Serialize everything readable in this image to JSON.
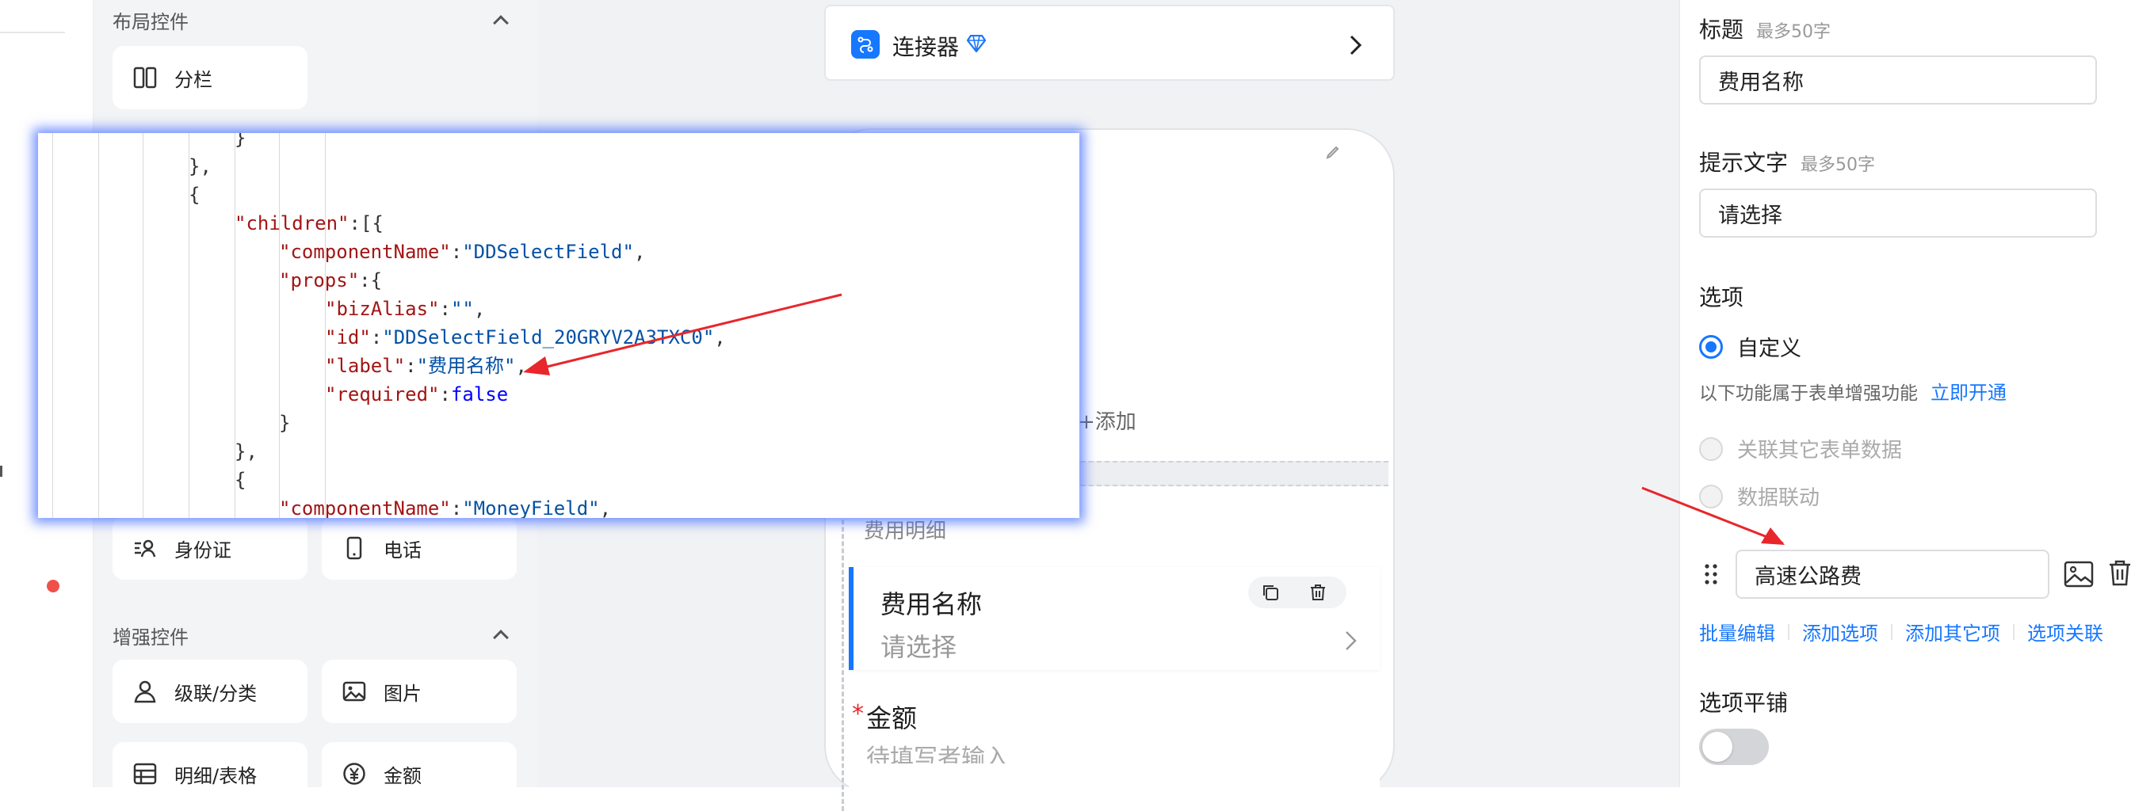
{
  "layout_panel": {
    "section_layout": "布局控件",
    "tile_columns": "分栏",
    "tile_idcard": "身份证",
    "tile_phone": "电话",
    "section_enhanced": "增强控件",
    "tile_cascade": "级联/分类",
    "tile_image": "图片",
    "tile_detail": "明细/表格",
    "tile_amount": "金额"
  },
  "canvas": {
    "connector_label": "连接器",
    "add_label": "+添加",
    "detail_title": "费用明细",
    "field_name_label": "费用名称",
    "field_name_placeholder": "请选择",
    "amount_required": "*",
    "amount_label": "金额",
    "amount_placeholder": "待填写者输入"
  },
  "props": {
    "title_label": "标题",
    "title_hint": "最多50字",
    "title_value": "费用名称",
    "placeholder_label": "提示文字",
    "placeholder_hint": "最多50字",
    "placeholder_value": "请选择",
    "options_label": "选项",
    "custom_label": "自定义",
    "enhance_notice": "以下功能属于表单增强功能",
    "enable_link": "立即开通",
    "link_other_form": "关联其它表单数据",
    "data_linkage": "数据联动",
    "option_value": "高速公路费",
    "batch_edit": "批量编辑",
    "add_option": "添加选项",
    "add_other": "添加其它项",
    "option_link": "选项关联",
    "tile_toggle_label": "选项平铺",
    "tile_toggle_on": false
  },
  "code_lines": [
    "}",
    "},",
    "{",
    "\"children\":[{",
    "\"componentName\":\"DDSelectField\",",
    "\"props\":{",
    "\"bizAlias\":\"\",",
    "\"id\":\"DDSelectField_20GRYV2A3TXC0\",",
    "\"label\":\"费用名称\",",
    "\"required\":false",
    "}",
    "},",
    "{",
    "\"componentName\":\"MoneyField\","
  ],
  "colors": {
    "accent": "#1677ff",
    "arrow": "#e8262b",
    "key": "#a31515",
    "string": "#0451a5",
    "keyword": "#0000ff"
  }
}
